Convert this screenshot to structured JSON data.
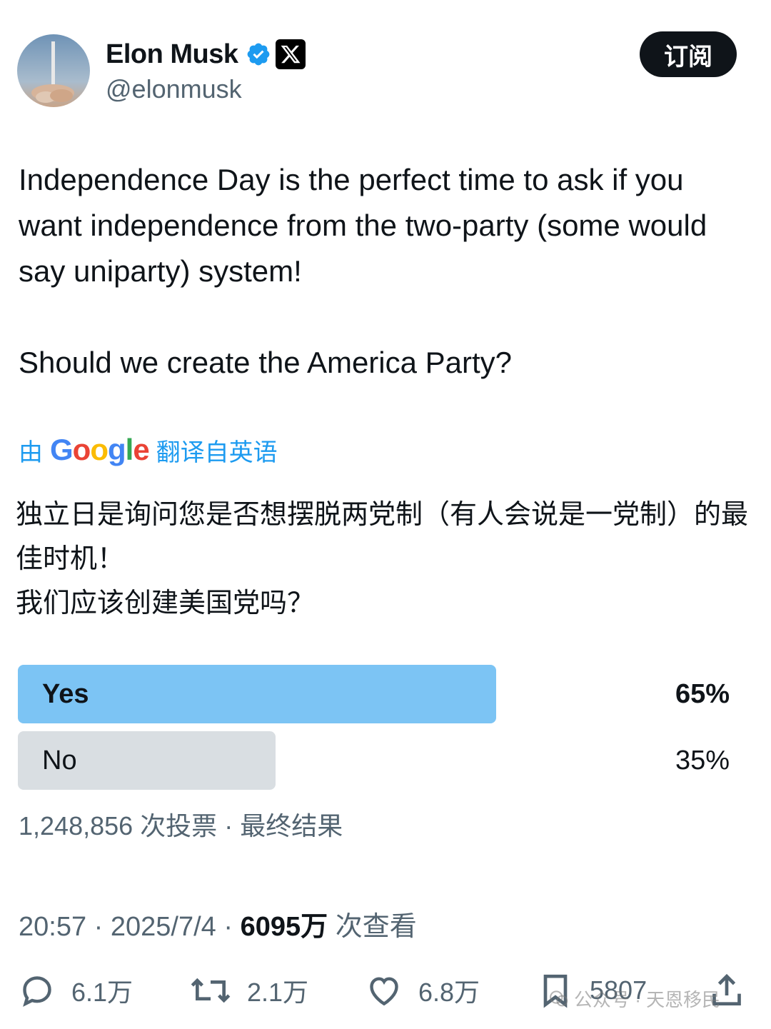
{
  "author": {
    "display_name": "Elon Musk",
    "handle": "@elonmusk"
  },
  "header": {
    "subscribe_label": "订阅"
  },
  "tweet": {
    "line1": "Independence Day is the perfect time to ask if you want independence from the two-party (some would say uniparty) system!",
    "line2": "Should we create the America Party?"
  },
  "translate": {
    "prefix": "由",
    "google": "Google",
    "suffix": "翻译自英语",
    "colors": [
      "#4285F4",
      "#EA4335",
      "#FBBC05",
      "#4285F4",
      "#34A853",
      "#EA4335"
    ]
  },
  "translation": {
    "line1": "独立日是询问您是否想摆脱两党制（有人会说是一党制）的最佳时机！",
    "line2": "我们应该创建美国党吗？"
  },
  "poll": {
    "options": [
      {
        "label": "Yes",
        "percent_text": "65%",
        "percent": 65,
        "winner": true
      },
      {
        "label": "No",
        "percent_text": "35%",
        "percent": 35,
        "winner": false
      }
    ],
    "votes": "1,248,856 次投票",
    "separator": "·",
    "status": "最终结果"
  },
  "meta": {
    "time": "20:57",
    "date": "2025/7/4",
    "views": "6095万",
    "views_suffix": "次查看"
  },
  "actions": {
    "reply_count": "6.1万",
    "repost_count": "2.1万",
    "like_count": "6.8万",
    "bookmark_count": "5807"
  },
  "watermark": {
    "text": "公众号 · 天恩移民"
  },
  "colors": {
    "accent": "#1d9bf0",
    "poll_winner": "#7cc4f4",
    "poll_other": "#d9dee2",
    "text_secondary": "#536471",
    "text_primary": "#0f1419"
  }
}
